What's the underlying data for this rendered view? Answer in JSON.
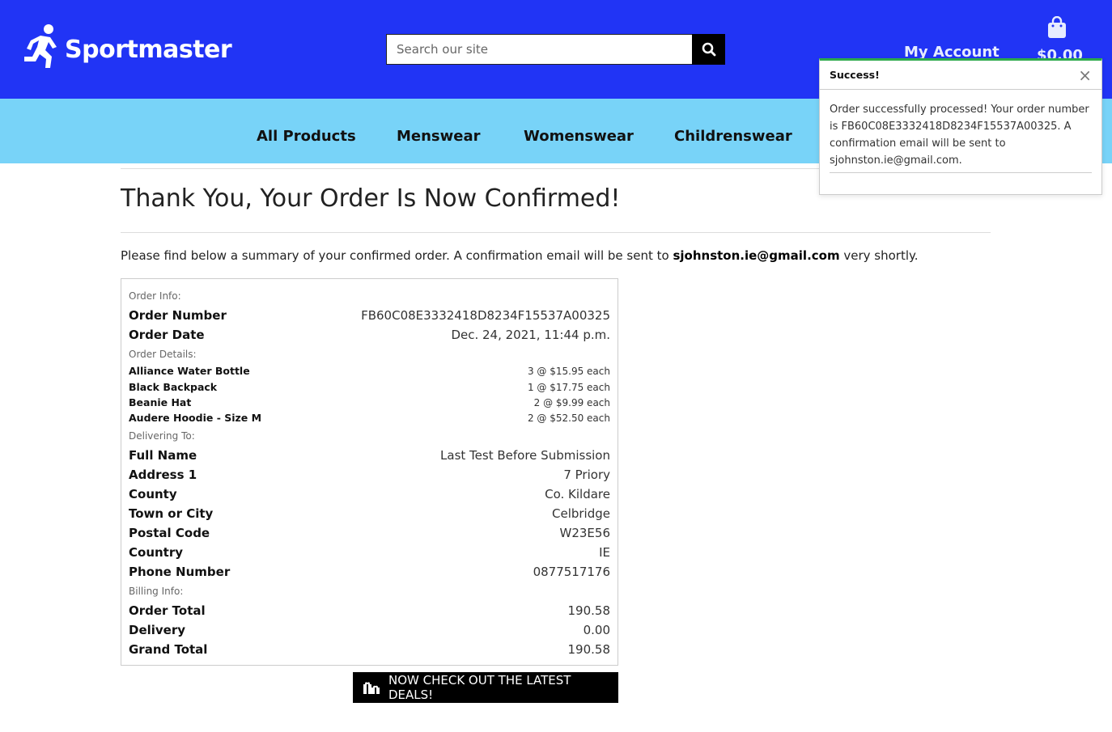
{
  "header": {
    "brand": "Sportmaster",
    "search_placeholder": "Search our site",
    "account_label": "My Account",
    "cart_total": "$0.00"
  },
  "nav": {
    "items": [
      "All Products",
      "Menswear",
      "Womenswear",
      "Childrenswear"
    ]
  },
  "page": {
    "title": "Thank You, Your Order Is Now Confirmed!",
    "intro_before": "Please find below a summary of your confirmed order. A confirmation email will be sent to ",
    "intro_email": "sjohnston.ie@gmail.com",
    "intro_after": " very shortly."
  },
  "order": {
    "info_heading": "Order Info:",
    "number_label": "Order Number",
    "number": "FB60C08E3332418D8234F15537A00325",
    "date_label": "Order Date",
    "date": "Dec. 24, 2021, 11:44 p.m.",
    "details_heading": "Order Details:",
    "items": [
      {
        "name": "Alliance Water Bottle",
        "qty": "3 @ $15.95 each"
      },
      {
        "name": "Black Backpack",
        "qty": "1 @ $17.75 each"
      },
      {
        "name": "Beanie Hat",
        "qty": "2 @ $9.99 each"
      },
      {
        "name": "Audere Hoodie - Size M",
        "qty": "2 @ $52.50 each"
      }
    ],
    "delivery_heading": "Delivering To:",
    "delivery": [
      {
        "label": "Full Name",
        "value": "Last Test Before Submission"
      },
      {
        "label": "Address 1",
        "value": "7 Priory"
      },
      {
        "label": "County",
        "value": "Co. Kildare"
      },
      {
        "label": "Town or City",
        "value": "Celbridge"
      },
      {
        "label": "Postal Code",
        "value": "W23E56"
      },
      {
        "label": "Country",
        "value": "IE"
      },
      {
        "label": "Phone Number",
        "value": "0877517176"
      }
    ],
    "billing_heading": "Billing Info:",
    "billing": [
      {
        "label": "Order Total",
        "value": "190.58"
      },
      {
        "label": "Delivery",
        "value": "0.00"
      },
      {
        "label": "Grand Total",
        "value": "190.58"
      }
    ]
  },
  "deals_button": "NOW CHECK OUT THE LATEST DEALS!",
  "toast": {
    "title": "Success!",
    "message": "Order successfully processed! Your order number is FB60C08E3332418D8234F15537A00325. A confirmation email will be sent to sjohnston.ie@gmail.com."
  }
}
